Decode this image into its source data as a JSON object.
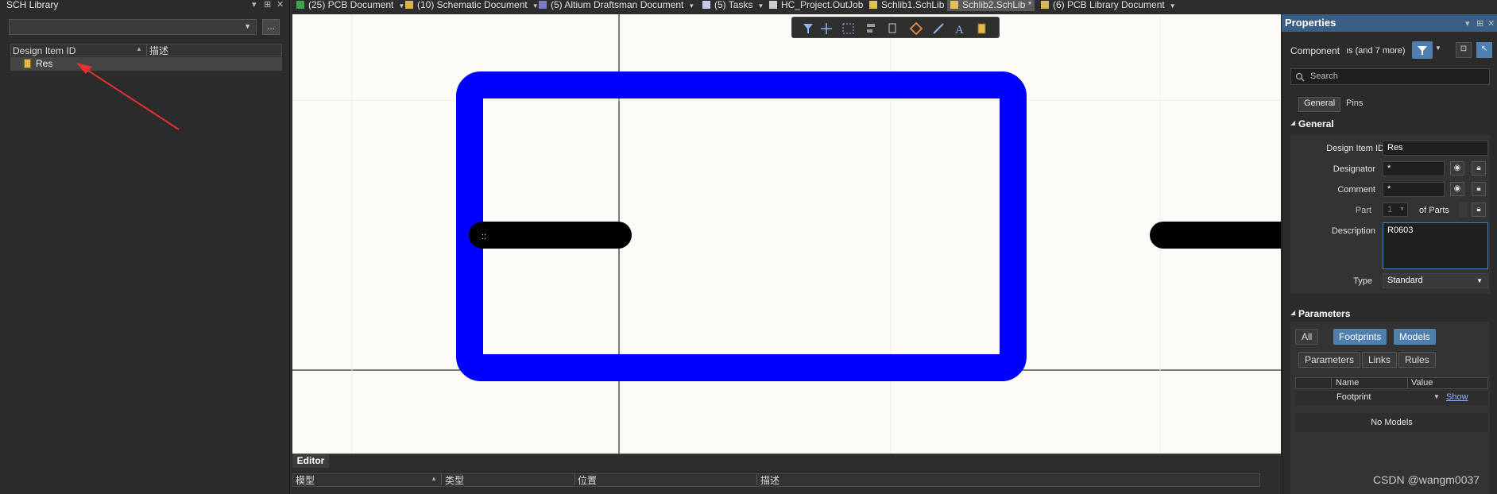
{
  "left_panel": {
    "title": "SCH Library",
    "controls": [
      "▾",
      "⊞",
      "✕"
    ],
    "filter_value": "",
    "browse_label": "...",
    "columns": [
      "Design Item ID",
      "描述"
    ],
    "rows": [
      {
        "id": "Res",
        "desc": ""
      }
    ]
  },
  "tabs": [
    {
      "label": "(25) PCB Document",
      "icon_color": "#3fa34d",
      "dropdown": true
    },
    {
      "label": "(10) Schematic Document",
      "icon_color": "#d9b24a",
      "dropdown": true
    },
    {
      "label": "(5) Altium Draftsman Document",
      "icon_color": "#7a7acb",
      "dropdown": true
    },
    {
      "label": "(5) Tasks",
      "icon_color": "#c8c8e8",
      "dropdown": true
    },
    {
      "label": "HC_Project.OutJob",
      "icon_color": "#cfcfcf",
      "dropdown": false
    },
    {
      "label": "Schlib1.SchLib",
      "icon_color": "#e0c15a",
      "dropdown": false
    },
    {
      "label": "Schlib2.SchLib *",
      "icon_color": "#e0c15a",
      "dropdown": false,
      "active": true
    },
    {
      "label": "(6) PCB Library Document",
      "icon_color": "#d8b65a",
      "dropdown": true
    }
  ],
  "toolbar": {
    "icons": [
      "filter-icon",
      "cross-icon",
      "select-rect-icon",
      "align-icon",
      "pin-icon",
      "fill-icon",
      "line-icon",
      "text-icon",
      "part-icon"
    ]
  },
  "canvas": {
    "pin_label": "::",
    "colors": {
      "body": "#0000ff",
      "pin": "#000000",
      "background": "#fdfbf6"
    }
  },
  "editor": {
    "tab_label": "Editor",
    "columns": [
      "模型",
      "类型",
      "位置",
      "描述"
    ]
  },
  "properties": {
    "title": "Properties",
    "title_controls": [
      "▾",
      "⊞",
      "✕"
    ],
    "component_label": "Component",
    "component_summary": "ıs (and 7 more)",
    "search_placeholder": "Search",
    "tabs": [
      "General",
      "Pins"
    ],
    "general_section": "General",
    "fields": {
      "design_item_id_label": "Design Item ID",
      "design_item_id": "Res",
      "designator_label": "Designator",
      "designator": "*",
      "comment_label": "Comment",
      "comment": "*",
      "part_label": "Part",
      "part_value": "1",
      "of_parts": "of Parts",
      "description_label": "Description",
      "description": "R0603",
      "type_label": "Type",
      "type_value": "Standard"
    },
    "parameters_section": "Parameters",
    "param_buttons_row1": [
      "All",
      "Footprints",
      "Models"
    ],
    "param_buttons_row2": [
      "Parameters",
      "Links",
      "Rules"
    ],
    "table_columns": [
      "Name",
      "Value"
    ],
    "table_row": {
      "name": "Footprint",
      "action": "Show"
    },
    "empty_text": "No Models"
  },
  "watermark": "CSDN @wangm0037"
}
